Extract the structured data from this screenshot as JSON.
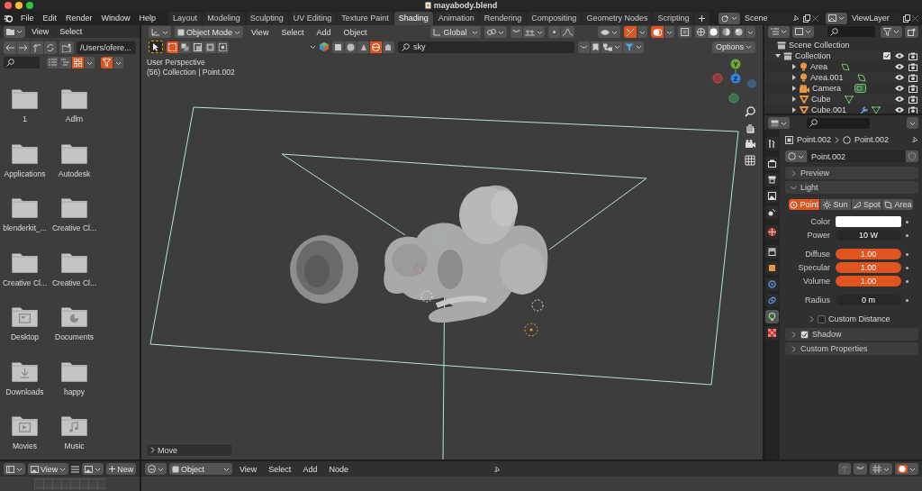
{
  "window": {
    "title": "mayabody.blend"
  },
  "menu": [
    "File",
    "Edit",
    "Render",
    "Window",
    "Help"
  ],
  "workspaces": [
    {
      "label": "Layout",
      "selected": false
    },
    {
      "label": "Modeling",
      "selected": false
    },
    {
      "label": "Sculpting",
      "selected": false
    },
    {
      "label": "UV Editing",
      "selected": false
    },
    {
      "label": "Texture Paint",
      "selected": false
    },
    {
      "label": "Shading",
      "selected": true
    },
    {
      "label": "Animation",
      "selected": false
    },
    {
      "label": "Rendering",
      "selected": false
    },
    {
      "label": "Compositing",
      "selected": false
    },
    {
      "label": "Geometry Nodes",
      "selected": false
    },
    {
      "label": "Scripting",
      "selected": false
    }
  ],
  "scene": "Scene",
  "view_layer": "ViewLayer",
  "file_browser": {
    "menu": [
      "View",
      "Select"
    ],
    "path": "/Users/ofere...",
    "items": [
      {
        "name": "1",
        "kind": "folder"
      },
      {
        "name": "Adlm",
        "kind": "folder"
      },
      {
        "name": "Applications",
        "kind": "folder"
      },
      {
        "name": "Autodesk",
        "kind": "folder"
      },
      {
        "name": "blenderkit_...",
        "kind": "folder"
      },
      {
        "name": "Creative Cl...",
        "kind": "folder"
      },
      {
        "name": "Creative Cl...",
        "kind": "folder"
      },
      {
        "name": "Creative Cl...",
        "kind": "folder"
      },
      {
        "name": "Desktop",
        "kind": "desktop"
      },
      {
        "name": "Documents",
        "kind": "documents"
      },
      {
        "name": "Downloads",
        "kind": "downloads"
      },
      {
        "name": "happy",
        "kind": "folder"
      },
      {
        "name": "Movies",
        "kind": "movies"
      },
      {
        "name": "Music",
        "kind": "music"
      }
    ]
  },
  "viewport": {
    "mode": "Object Mode",
    "menu": [
      "View",
      "Select",
      "Add",
      "Object"
    ],
    "orientation": "Global",
    "search": "sky",
    "options": "Options",
    "perspective": "User Perspective",
    "context": "(56) Collection | Point.002",
    "last_operator": "Move",
    "axis_labels": [
      "Y",
      "Z"
    ]
  },
  "outliner": {
    "root": "Scene Collection",
    "items": [
      {
        "name": "Collection",
        "kind": "collection",
        "expanded": true,
        "children": [
          {
            "name": "Area",
            "kind": "light",
            "modifiers": false
          },
          {
            "name": "Area.001",
            "kind": "light",
            "modifiers": false
          },
          {
            "name": "Camera",
            "kind": "camera",
            "modifiers": false
          },
          {
            "name": "Cube",
            "kind": "mesh",
            "modifiers": false
          },
          {
            "name": "Cube.001",
            "kind": "mesh",
            "modifiers": true
          }
        ]
      }
    ]
  },
  "properties": {
    "tabs": [
      {
        "kind": "tool",
        "selected": false
      },
      {
        "kind": "render",
        "selected": false
      },
      {
        "kind": "output",
        "selected": false
      },
      {
        "kind": "view",
        "selected": false
      },
      {
        "kind": "scene",
        "selected": false
      },
      {
        "kind": "world",
        "selected": false
      },
      {
        "kind": "collection",
        "selected": false
      },
      {
        "kind": "object",
        "selected": false
      },
      {
        "kind": "modifier",
        "selected": false
      },
      {
        "kind": "physics",
        "selected": false
      },
      {
        "kind": "data",
        "selected": true
      },
      {
        "kind": "texture",
        "selected": false
      }
    ],
    "breadcrumb": [
      "Point.002",
      "Point.002"
    ],
    "datablock": "Point.002",
    "preview": {
      "title": "Preview",
      "expanded": false
    },
    "light": {
      "title": "Light",
      "expanded": true,
      "types": [
        {
          "label": "Point",
          "selected": true
        },
        {
          "label": "Sun",
          "selected": false
        },
        {
          "label": "Spot",
          "selected": false
        },
        {
          "label": "Area",
          "selected": false
        }
      ],
      "fields": [
        {
          "label": "Color",
          "kind": "color",
          "color": "#ffffff"
        },
        {
          "label": "Power",
          "kind": "number",
          "value": "10 W"
        },
        {
          "label": "Diffuse",
          "kind": "slider",
          "value": "1.00",
          "level": 1
        },
        {
          "label": "Specular",
          "kind": "slider",
          "value": "1.00",
          "level": 1
        },
        {
          "label": "Volume",
          "kind": "slider",
          "value": "1.00",
          "level": 1
        },
        {
          "label": "Radius",
          "kind": "number",
          "value": "0 m"
        }
      ],
      "custom_distance": {
        "label": "Custom Distance",
        "checked": false
      }
    },
    "shadow": {
      "title": "Shadow",
      "checked": true
    },
    "custom_properties": {
      "title": "Custom Properties"
    }
  },
  "shader_editor": {
    "object": "Object",
    "menu": [
      "View",
      "Select",
      "Add",
      "Node"
    ]
  },
  "image_editor": {
    "view": "View",
    "new": "New"
  }
}
